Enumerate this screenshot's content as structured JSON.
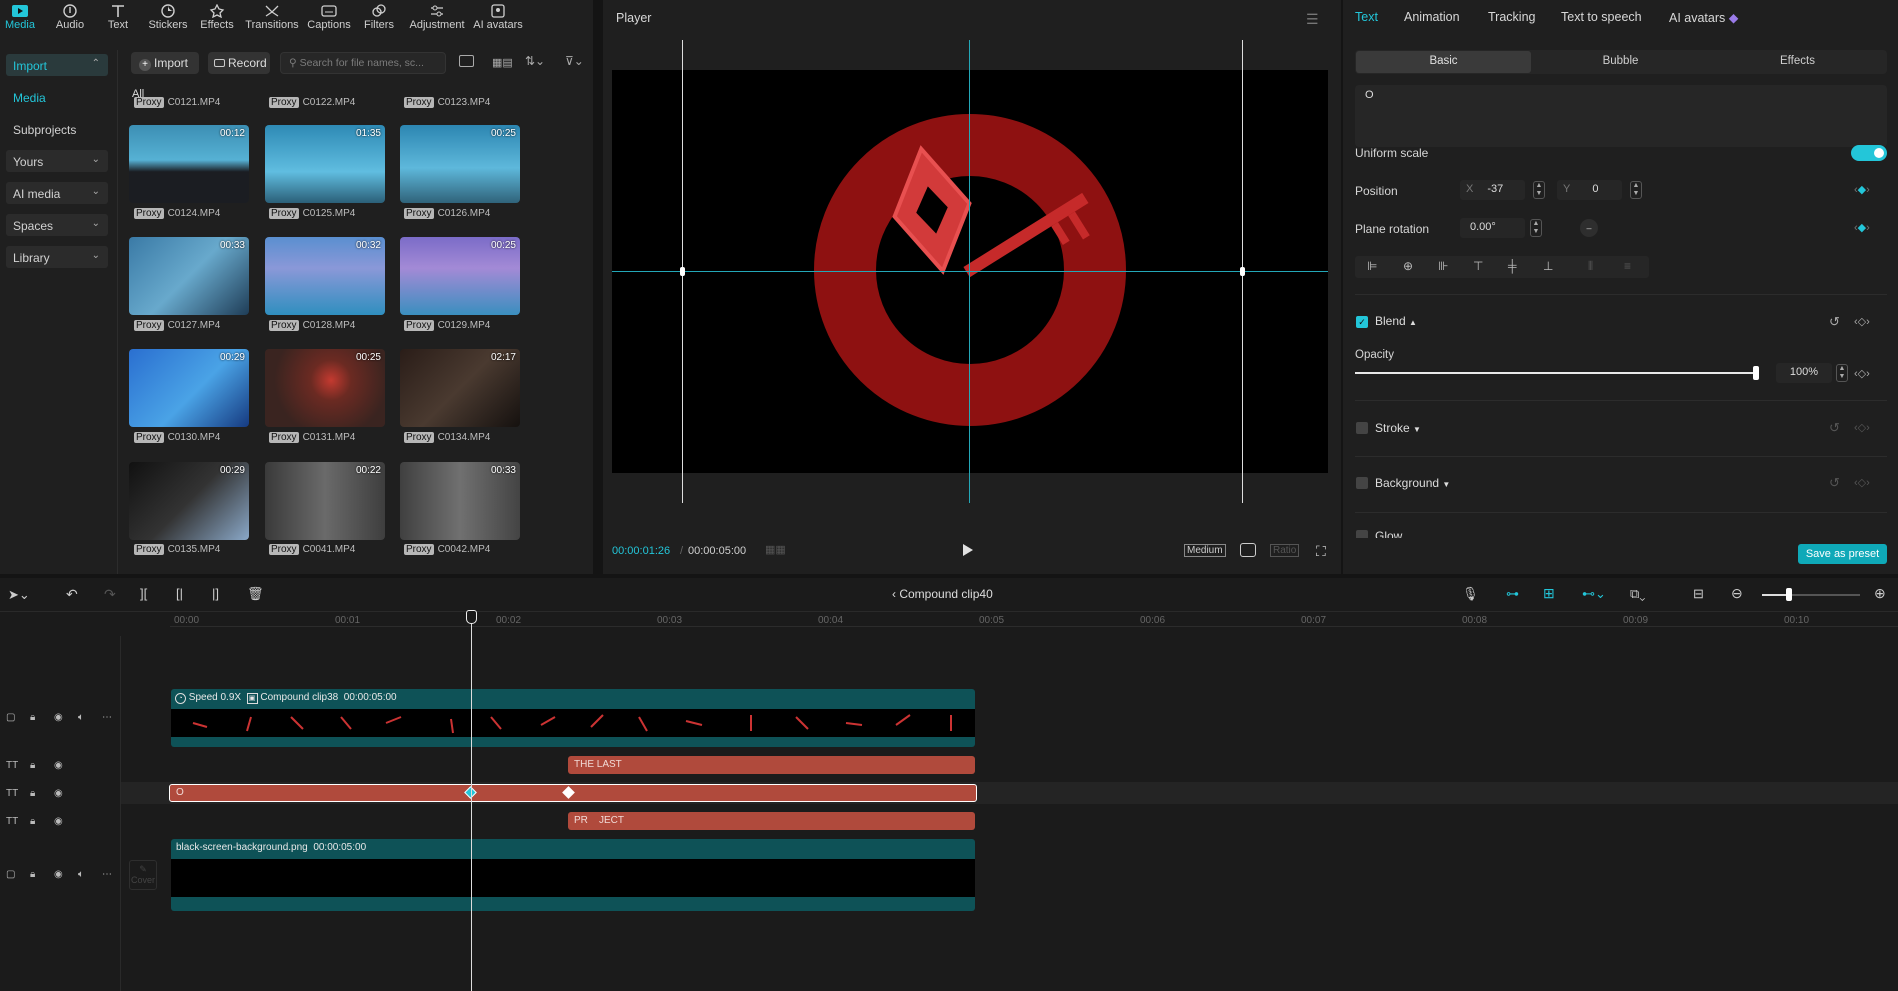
{
  "toolbar": {
    "tools": [
      {
        "label": "Media",
        "icon": "media-icon",
        "active": true
      },
      {
        "label": "Audio",
        "icon": "audio-icon"
      },
      {
        "label": "Text",
        "icon": "text-icon"
      },
      {
        "label": "Stickers",
        "icon": "stickers-icon"
      },
      {
        "label": "Effects",
        "icon": "effects-icon"
      },
      {
        "label": "Transitions",
        "icon": "transitions-icon"
      },
      {
        "label": "Captions",
        "icon": "captions-icon"
      },
      {
        "label": "Filters",
        "icon": "filters-icon"
      },
      {
        "label": "Adjustment",
        "icon": "adjustment-icon"
      },
      {
        "label": "AI avatars",
        "icon": "ai-avatars-icon"
      }
    ]
  },
  "media_nav": {
    "items": [
      "Import",
      "Media",
      "Subprojects",
      "Yours",
      "AI media",
      "Spaces",
      "Library"
    ]
  },
  "media": {
    "import_label": "Import",
    "record_label": "Record",
    "search_placeholder": "Search for file names, sc...",
    "filter_all": "All",
    "proxy_tag": "Proxy",
    "top_captions": [
      "C0121.MP4",
      "C0122.MP4",
      "C0123.MP4"
    ],
    "clips": [
      {
        "name": "C0124.MP4",
        "duration": "00:12"
      },
      {
        "name": "C0125.MP4",
        "duration": "01:35"
      },
      {
        "name": "C0126.MP4",
        "duration": "00:25"
      },
      {
        "name": "C0127.MP4",
        "duration": "00:33"
      },
      {
        "name": "C0128.MP4",
        "duration": "00:32"
      },
      {
        "name": "C0129.MP4",
        "duration": "00:25"
      },
      {
        "name": "C0130.MP4",
        "duration": "00:29"
      },
      {
        "name": "C0131.MP4",
        "duration": "00:25"
      },
      {
        "name": "C0134.MP4",
        "duration": "02:17"
      },
      {
        "name": "C0135.MP4",
        "duration": "00:29"
      },
      {
        "name": "C0041.MP4",
        "duration": "00:22"
      },
      {
        "name": "C0042.MP4",
        "duration": "00:33"
      }
    ]
  },
  "player": {
    "title": "Player",
    "current_time": "00:00:01:26",
    "total_time": "00:00:05:00",
    "quality": "Medium",
    "ratio": "Ratio"
  },
  "inspector": {
    "tabs": [
      "Text",
      "Animation",
      "Tracking",
      "Text to speech",
      "AI avatars"
    ],
    "subtabs": [
      "Basic",
      "Bubble",
      "Effects"
    ],
    "text_value": "O",
    "uniform_scale": "Uniform scale",
    "position_label": "Position",
    "pos_x_label": "X",
    "pos_x": "-37",
    "pos_y_label": "Y",
    "pos_y": "0",
    "rotation_label": "Plane rotation",
    "rotation": "0.00°",
    "blend_label": "Blend",
    "opacity_label": "Opacity",
    "opacity": "100%",
    "opacity_fraction": 1.0,
    "stroke_label": "Stroke",
    "background_label": "Background",
    "glow_label": "Glow",
    "save_preset": "Save as preset"
  },
  "timeline": {
    "clip_title": "Compound clip40",
    "ruler": [
      "00:00",
      "00:01",
      "00:02",
      "00:03",
      "00:04",
      "00:05",
      "00:06",
      "00:07",
      "00:08",
      "00:09",
      "00:10"
    ],
    "video_track": {
      "speed": "Speed 0.9X",
      "name": "Compound clip38",
      "duration": "00:00:05:00"
    },
    "text1": "THE LAST",
    "text2": "O",
    "text3": "PR    JECT",
    "bg_track": {
      "name": "black-screen-background.png",
      "duration": "00:00:05:00"
    },
    "cover_label": "Cover"
  },
  "colors": {
    "accent": "#23c6d9",
    "text_clip": "#b04a3c",
    "video_track": "#0e5257",
    "ring": "#8e1111"
  }
}
